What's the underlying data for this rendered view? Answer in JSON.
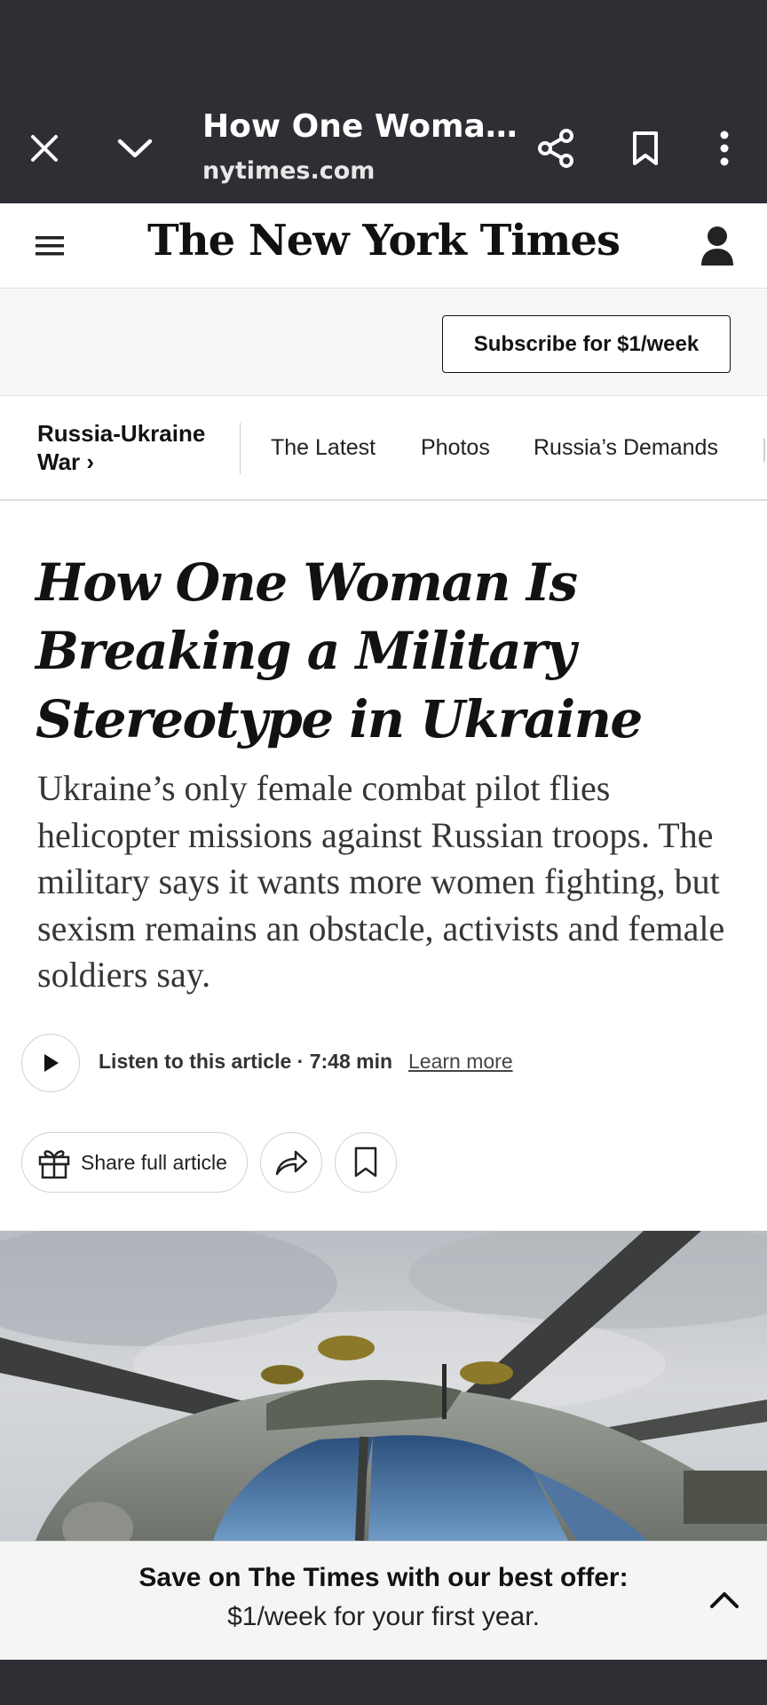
{
  "browser": {
    "title": "How One Woma…",
    "url": "nytimes.com",
    "icons": [
      "close-icon",
      "chevron-down-icon",
      "share-icon",
      "bookmark-icon",
      "more-vert-icon"
    ]
  },
  "masthead": {
    "logo": "The New York Times",
    "icons": [
      "hamburger-menu-icon",
      "account-icon"
    ]
  },
  "subscribe": {
    "label": "Subscribe for $1/week"
  },
  "section_nav": {
    "section_line1": "Russia-Ukraine",
    "section_line2": "War",
    "section_arrow": "›",
    "links": [
      "The Latest",
      "Photos",
      "Russia’s Demands"
    ]
  },
  "article": {
    "headline": "How One Woman Is Breaking a Military Stereotype in Ukraine",
    "summary": "Ukraine’s only female combat pilot flies helicopter missions against Russian troops. The military says it wants more women fighting, but sexism remains an obstacle, activists and female soldiers say.",
    "listen_text": "Listen to this article · 7:48 min",
    "learn_more": "Learn more",
    "share_label": "Share full article"
  },
  "offer": {
    "line1": "Save on The Times with our best offer:",
    "line2": "$1/week for your first year."
  },
  "colors": {
    "chrome_bg": "#2e2f34",
    "text": "#121212",
    "summary_text": "#363636",
    "offer_bg": "#f5f5f5"
  }
}
